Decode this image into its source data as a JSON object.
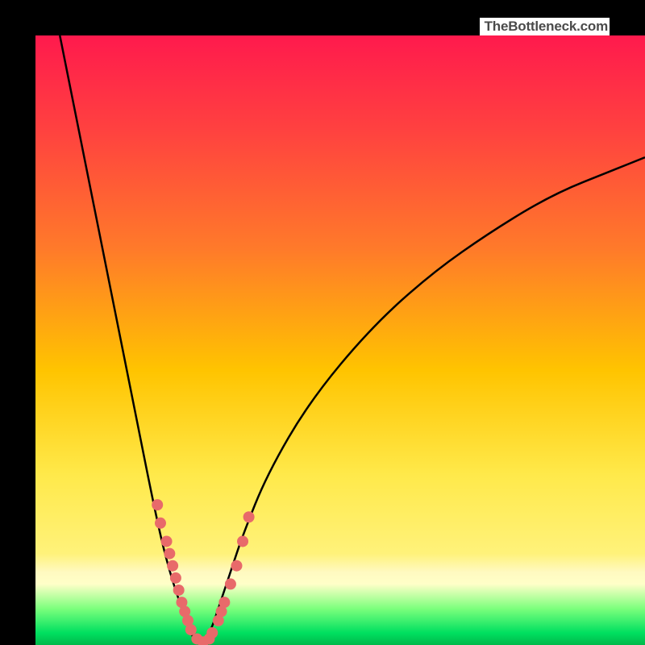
{
  "watermark": "TheBottleneck.com",
  "chart_data": {
    "type": "line",
    "title": "",
    "xlabel": "",
    "ylabel": "",
    "xlim": [
      0,
      100
    ],
    "ylim": [
      0,
      100
    ],
    "grid": false,
    "legend": false,
    "description": "Bottleneck curve over rainbow gradient (red = bad, green = good). Y-axis: bottleneck percent (top=100%, bottom=0%). X-axis: relative hardware strength. Minimum (0%) around x≈27. Red dots mark sampled data points near the minimum.",
    "series": [
      {
        "name": "bottleneck-curve",
        "color": "#000000",
        "x": [
          4,
          8,
          12,
          16,
          20,
          22,
          24,
          25,
          26,
          27,
          28,
          29,
          30,
          32,
          34,
          38,
          45,
          55,
          65,
          75,
          85,
          95,
          100
        ],
        "y": [
          100,
          80,
          60,
          40,
          20,
          12,
          6,
          3,
          1,
          0,
          1,
          3,
          6,
          12,
          18,
          28,
          40,
          52,
          61,
          68,
          74,
          78,
          80
        ]
      }
    ],
    "scatter": {
      "name": "sample-points",
      "color": "#e86a6a",
      "radius_px": 7,
      "points": [
        {
          "x": 20.0,
          "y": 23
        },
        {
          "x": 20.5,
          "y": 20
        },
        {
          "x": 21.5,
          "y": 17
        },
        {
          "x": 22.0,
          "y": 15
        },
        {
          "x": 22.5,
          "y": 13
        },
        {
          "x": 23.0,
          "y": 11
        },
        {
          "x": 23.5,
          "y": 9
        },
        {
          "x": 24.0,
          "y": 7
        },
        {
          "x": 24.5,
          "y": 5.5
        },
        {
          "x": 25.0,
          "y": 4
        },
        {
          "x": 25.5,
          "y": 2.5
        },
        {
          "x": 26.5,
          "y": 1
        },
        {
          "x": 27.5,
          "y": 0.5
        },
        {
          "x": 28.5,
          "y": 1
        },
        {
          "x": 29.0,
          "y": 2
        },
        {
          "x": 30.0,
          "y": 4
        },
        {
          "x": 30.5,
          "y": 5.5
        },
        {
          "x": 31.0,
          "y": 7
        },
        {
          "x": 32.0,
          "y": 10
        },
        {
          "x": 33.0,
          "y": 13
        },
        {
          "x": 34.0,
          "y": 17
        },
        {
          "x": 35.0,
          "y": 21
        }
      ]
    }
  }
}
